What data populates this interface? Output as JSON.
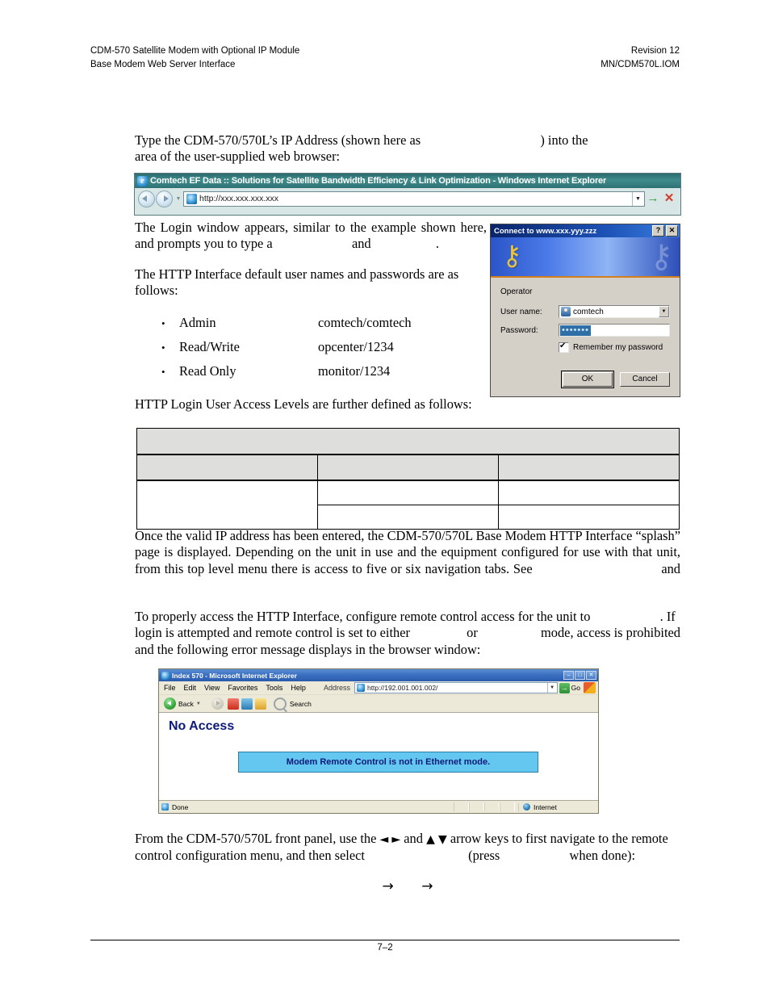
{
  "header": {
    "left_line1": "CDM-570 Satellite Modem with Optional IP Module",
    "left_line2": "Base Modem Web Server Interface",
    "right_line1": "Revision 12",
    "right_line2": "MN/CDM570L.IOM"
  },
  "footer": {
    "page_number": "7–2"
  },
  "paragraphs": {
    "p1_a": "Type the CDM-570/570L’s IP Address (shown here as",
    "p1_b": ") into the",
    "p1_c": "area of the user-supplied web browser:",
    "p2_a": "The Login window appears, similar to the example shown here, and prompts you to type a",
    "p2_b": "and",
    "p2_c": ".",
    "p3": "The HTTP Interface default user names and passwords are as follows:",
    "p4": "HTTP Login User Access Levels are further defined as follows:",
    "p5_a": "Once the valid IP address has been entered, the CDM-570/570L Base Modem HTTP Interface “splash” page is displayed. Depending on the unit in use and the equipment configured for use with that unit, from this top level menu there is access to five or six navigation tabs. See",
    "p5_b": "and",
    "p6_a": "To properly access the HTTP Interface, configure remote control access for the unit to",
    "p6_b": ". If login is attempted and remote control is set to either",
    "p6_c": "or",
    "p6_d": "mode, access is prohibited and the following error message displays in the browser window:",
    "p7_a": "From the CDM-570/570L front panel, use the",
    "p7_left_arrow": "◄",
    "p7_right_arrow": "►",
    "p7_b": "and",
    "p7_up_arrow": "▲",
    "p7_down_arrow": "▼",
    "p7_c": "arrow keys to first navigate to the remote control configuration menu, and then select",
    "p7_d": "(press",
    "p7_e": "when done):",
    "arrow_glyph": "→"
  },
  "credentials": {
    "bullet_glyph": "•",
    "items": [
      {
        "level": "Admin",
        "value": "comtech/comtech"
      },
      {
        "level": "Read/Write",
        "value": "opcenter/1234"
      },
      {
        "level": "Read Only",
        "value": "monitor/1234"
      }
    ]
  },
  "access_levels_table": {
    "rows": [
      {
        "cells": [
          "",
          "",
          ""
        ]
      },
      {
        "cells": [
          "",
          "",
          ""
        ]
      },
      {
        "cells": [
          "",
          "",
          ""
        ]
      },
      {
        "cells": [
          "",
          "",
          ""
        ]
      }
    ]
  },
  "browser_window": {
    "title": "Comtech EF Data :: Solutions for Satellite Bandwidth Efficiency & Link Optimization - Windows Internet Explorer",
    "e_badge": "e",
    "url": "http://xxx.xxx.xxx.xxx",
    "back_icon": "back-arrow-icon",
    "forward_icon": "forward-arrow-icon",
    "go_glyph": "→",
    "stop_glyph": "✕",
    "dropdown_glyph": "▼"
  },
  "login_dialog": {
    "title": "Connect to www.xxx.yyy.zzz",
    "help_btn": "?",
    "close_btn": "✕",
    "keys_glyph": "⚷",
    "realm_label": "Operator",
    "username_label": "User name:",
    "username_value": "comtech",
    "password_label": "Password:",
    "password_value": "•••••••",
    "remember_label": "Remember my password",
    "ok_label": "OK",
    "cancel_label": "Cancel",
    "dropdown_glyph": "▼"
  },
  "no_access_window": {
    "title": "Index 570 - Microsoft Internet Explorer",
    "minimize_btn": "–",
    "maximize_btn": "□",
    "close_btn": "✕",
    "menu_items": [
      "File",
      "Edit",
      "View",
      "Favorites",
      "Tools",
      "Help"
    ],
    "address_label": "Address",
    "url": "http://192.001.001.002/",
    "go_label": "Go",
    "go_glyph": "→",
    "back_label": "Back",
    "back_caret": "▼",
    "search_label": "Search",
    "heading": "No Access",
    "message": "Modem Remote Control is not in Ethernet mode.",
    "status_text": "Done",
    "status_zone": "Internet",
    "dropdown_glyph": "▼"
  },
  "colors": {
    "ie7_titlebar": "#3f8b8b",
    "login_titlebar": "#0a246a",
    "ie6_titlebar": "#3a6fc0",
    "message_box_bg": "#64c7f0",
    "message_text": "#0d1a7a",
    "table_header_bg": "#dededd"
  }
}
